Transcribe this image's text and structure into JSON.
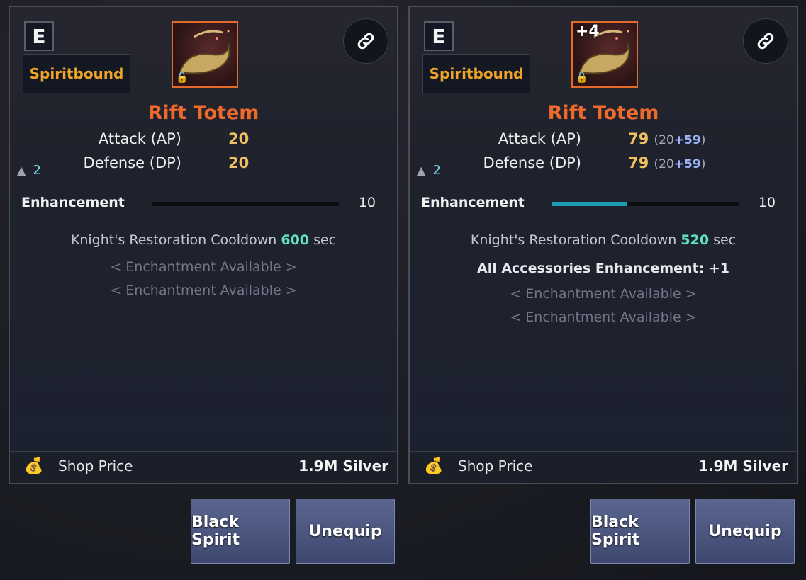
{
  "panels": [
    {
      "grade": "E",
      "bound": "Spiritbound",
      "icon": {
        "enhance_badge": "",
        "lock": "lock-icon"
      },
      "title": "Rift Totem",
      "stats": [
        {
          "label": "Attack (AP)",
          "value": "20",
          "breakdown_base": "",
          "breakdown_bonus": ""
        },
        {
          "label": "Defense (DP)",
          "value": "20",
          "breakdown_base": "",
          "breakdown_bonus": ""
        }
      ],
      "weight": "2",
      "enhancement": {
        "label": "Enhancement",
        "value": "10",
        "progress": 0
      },
      "cooldown": {
        "prefix": "Knight's Restoration Cooldown",
        "value": "600",
        "unit": "sec"
      },
      "extra_line": "",
      "enchant_lines": [
        "< Enchantment Available >",
        "< Enchantment Available >"
      ],
      "price": {
        "label": "Shop Price",
        "value": "1.9M Silver"
      },
      "buttons": {
        "black_spirit": "Black Spirit",
        "unequip": "Unequip"
      }
    },
    {
      "grade": "E",
      "bound": "Spiritbound",
      "icon": {
        "enhance_badge": "+4",
        "lock": "lock-icon"
      },
      "title": "Rift Totem",
      "stats": [
        {
          "label": "Attack (AP)",
          "value": "79",
          "breakdown_base": "(20",
          "breakdown_bonus": "+59"
        },
        {
          "label": "Defense (DP)",
          "value": "79",
          "breakdown_base": "(20",
          "breakdown_bonus": "+59"
        }
      ],
      "weight": "2",
      "enhancement": {
        "label": "Enhancement",
        "value": "10",
        "progress": 0.4
      },
      "cooldown": {
        "prefix": "Knight's Restoration Cooldown",
        "value": "520",
        "unit": "sec"
      },
      "extra_line": "All Accessories Enhancement: +1",
      "enchant_lines": [
        "< Enchantment Available >",
        "< Enchantment Available >"
      ],
      "price": {
        "label": "Shop Price",
        "value": "1.9M Silver"
      },
      "buttons": {
        "black_spirit": "Black Spirit",
        "unequip": "Unequip"
      }
    }
  ],
  "colors": {
    "title": "#ee6a2a",
    "bound": "#f0a42a",
    "teal": "#62e0c6",
    "enh_fill": "#1e9cb6"
  }
}
